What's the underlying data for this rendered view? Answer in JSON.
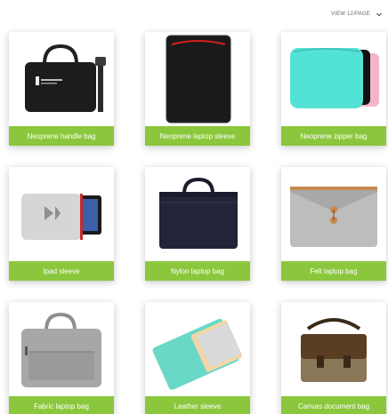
{
  "view_select": {
    "label": "VIEW 12/PAGE",
    "icon": "chevron-down-icon"
  },
  "theme": {
    "caption_bg": "#8bc73c",
    "caption_text": "#ffffff"
  },
  "products": [
    {
      "name": "Neoprene handle bag"
    },
    {
      "name": "Neoprene laptop sleeve"
    },
    {
      "name": "Neoprene zipper bag"
    },
    {
      "name": "Ipad sleeve"
    },
    {
      "name": "Nylon laptop bag"
    },
    {
      "name": "Felt laptop bag"
    },
    {
      "name": "Fabric laptop bag"
    },
    {
      "name": "Leather sleeve"
    },
    {
      "name": "Canvas document bag"
    }
  ]
}
